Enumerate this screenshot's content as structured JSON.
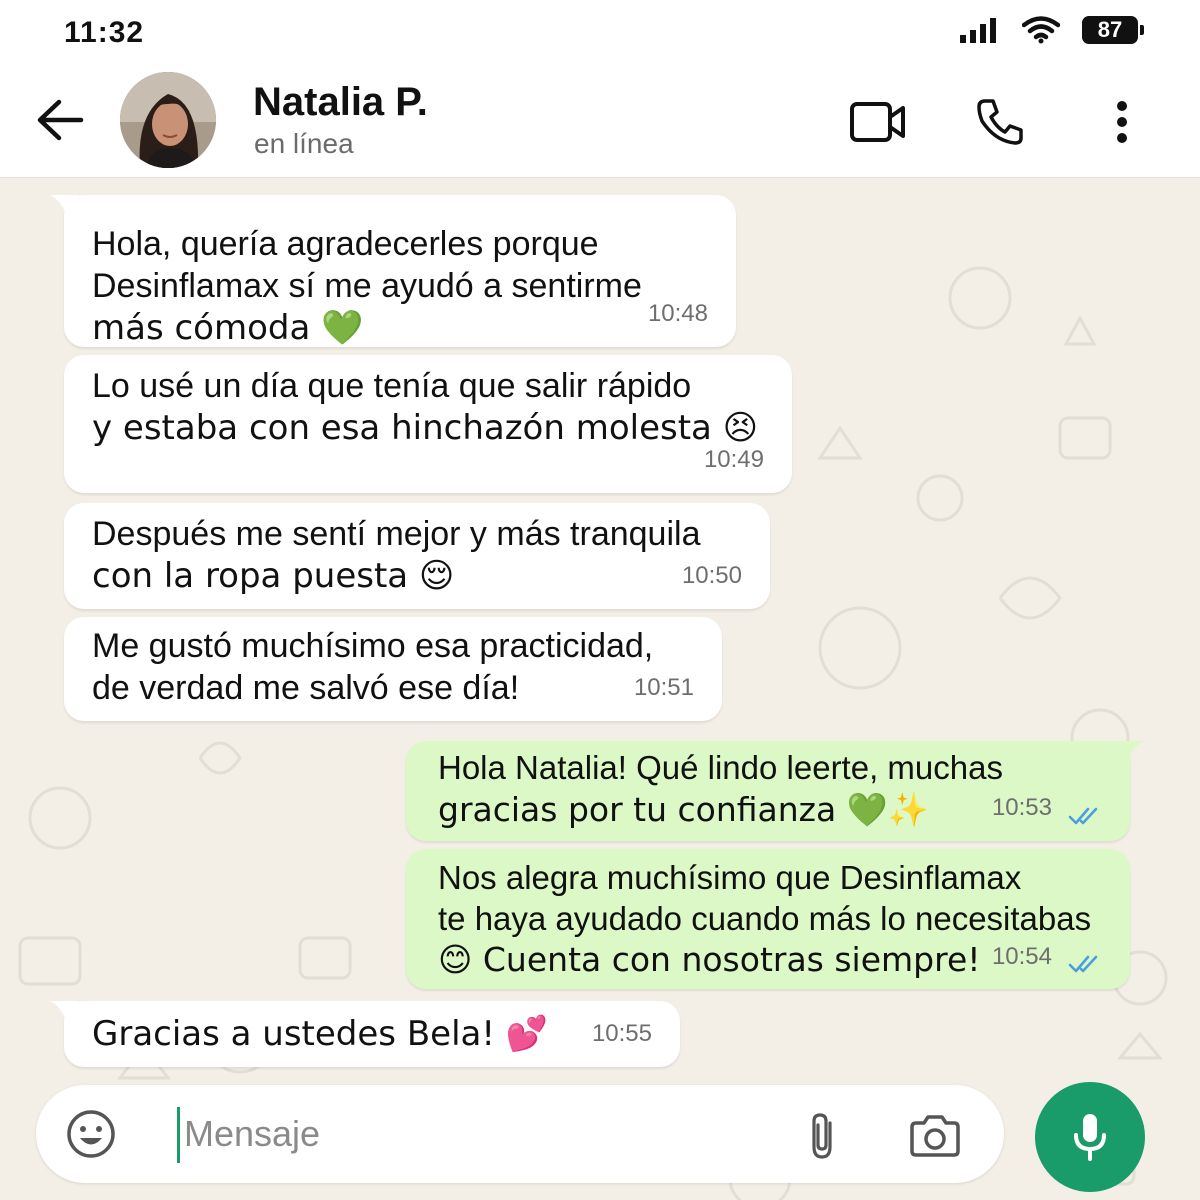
{
  "status_bar": {
    "time": "11:32",
    "battery": "87"
  },
  "header": {
    "contact_name": "Natalia P.",
    "contact_status": "en línea"
  },
  "messages": [
    {
      "direction": "incoming",
      "lines": [
        "Hola, quería agradecerles porque",
        "Desinflamax sí me ayudó a sentirme",
        "más cómoda 💚"
      ],
      "time": "10:48"
    },
    {
      "direction": "incoming",
      "lines": [
        "Lo usé un día que tenía que salir rápido",
        "y estaba con esa hinchazón molesta 😣"
      ],
      "time": "10:49"
    },
    {
      "direction": "incoming",
      "lines": [
        "Después me sentí mejor y más tranquila",
        "con la ropa puesta 😌"
      ],
      "time": "10:50"
    },
    {
      "direction": "incoming",
      "lines": [
        "Me gustó muchísimo esa practicidad,",
        "de verdad me salvó ese día!"
      ],
      "time": "10:51"
    },
    {
      "direction": "outgoing",
      "lines": [
        "Hola Natalia! Qué lindo leerte, muchas",
        "gracias por tu confianza 💚✨"
      ],
      "time": "10:53"
    },
    {
      "direction": "outgoing",
      "lines": [
        "Nos alegra muchísimo que Desinflamax",
        "te haya ayudado cuando más lo necesitabas",
        "😊 Cuenta con nosotras siempre!"
      ],
      "time": "10:54"
    },
    {
      "direction": "incoming",
      "lines": [
        "Gracias a ustedes Bela! 💕"
      ],
      "time": "10:55"
    }
  ],
  "input": {
    "placeholder": "Mensaje"
  },
  "colors": {
    "incoming_bubble": "#ffffff",
    "outgoing_bubble": "#dcf8c6",
    "accent": "#1a9b6a",
    "read_ticks": "#4a9fe0",
    "chat_background": "#f3efe6"
  },
  "icons": {
    "back": "arrow-left-icon",
    "video": "video-call-icon",
    "phone": "phone-icon",
    "menu": "more-vertical-icon",
    "emoji": "emoji-icon",
    "attach": "paperclip-icon",
    "camera": "camera-icon",
    "mic": "microphone-icon"
  }
}
